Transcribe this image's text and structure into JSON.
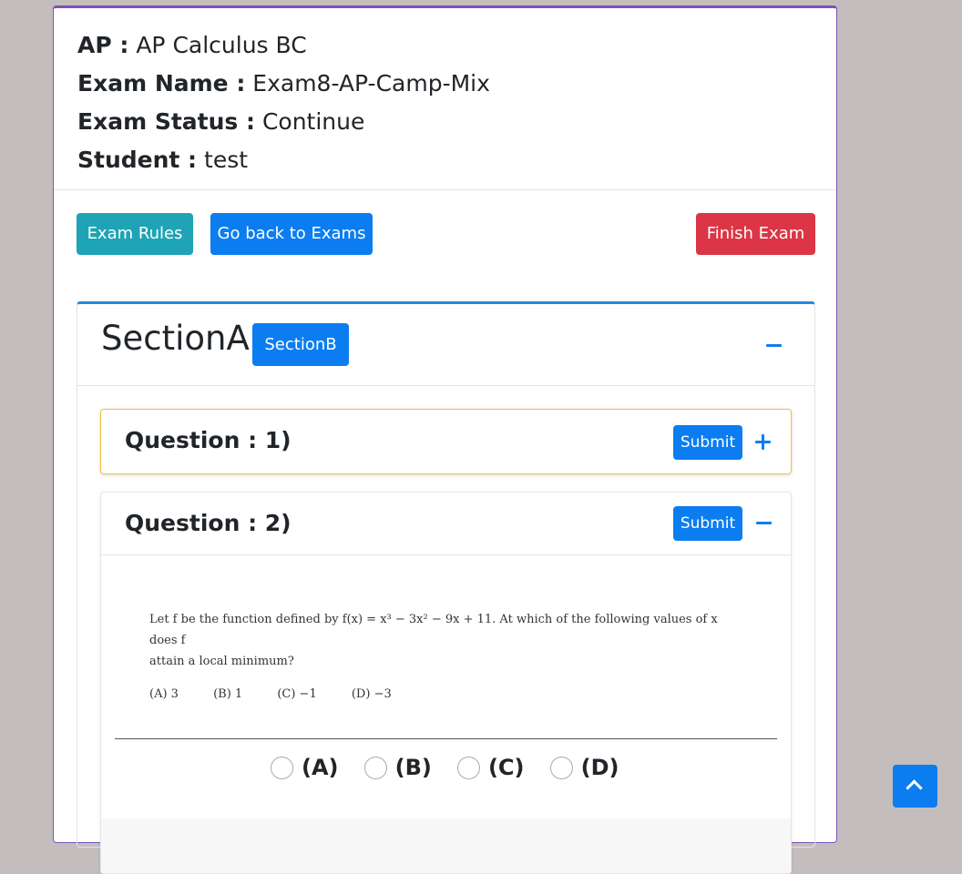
{
  "exam_info": {
    "ap_label": "AP :",
    "ap_value": "AP Calculus BC",
    "exam_name_label": "Exam Name :",
    "exam_name_value": "Exam8-AP-Camp-Mix",
    "exam_status_label": "Exam Status :",
    "exam_status_value": "Continue",
    "student_label": "Student :",
    "student_value": "test"
  },
  "actions": {
    "rules_label": "Exam Rules",
    "back_label": "Go back to Exams",
    "finish_label": "Finish Exam"
  },
  "section": {
    "title": "SectionA",
    "other_section_label": "SectionB",
    "collapse_icon": "minus-icon"
  },
  "questions": [
    {
      "title": "Question : 1)",
      "submit_label": "Submit",
      "toggle_icon": "plus-icon"
    },
    {
      "title": "Question : 2)",
      "submit_label": "Submit",
      "toggle_icon": "minus-icon",
      "problem_text_1": "Let f be the function defined by f(x) = x³ − 3x² − 9x + 11. At which of the following values of x does f",
      "problem_text_2": "attain a local minimum?",
      "choices": [
        "(A)  3",
        "(B)  1",
        "(C)  −1",
        "(D)  −3"
      ],
      "answer_options": [
        "(A)",
        "(B)",
        "(C)",
        "(D)"
      ]
    }
  ],
  "scroll_top_icon": "chevron-up-icon",
  "colors": {
    "primary": "#0b7df0",
    "info": "#1fa3b6",
    "danger": "#dc3545",
    "warning_border": "#f3c333",
    "card_border": "#7b52b9"
  }
}
